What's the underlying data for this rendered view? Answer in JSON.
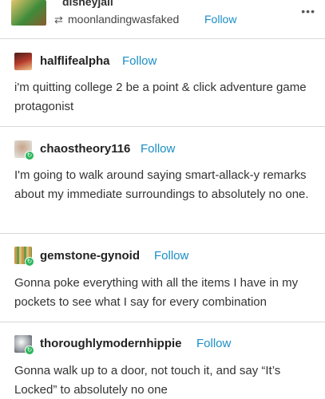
{
  "header": {
    "blog_name": "disneyjail",
    "reblog_icon": "reblog-icon",
    "reblogged_from": "moonlandingwasfaked",
    "follow_label": "Follow",
    "more_label": "•••"
  },
  "posts": [
    {
      "username": "halflifealpha",
      "follow_label": "Follow",
      "text": "i'm quitting college 2 be a point & click adventure game protagonist"
    },
    {
      "username": "chaostheory116",
      "follow_label": "Follow",
      "text": "I'm going to walk around saying smart-allack-y remarks about my immediate surroundings to absolutely no one."
    },
    {
      "username": "gemstone-gynoid",
      "follow_label": "Follow",
      "text": "Gonna poke everything with all the items I have in my pockets to see what I say for every combination"
    },
    {
      "username": "thoroughlymodernhippie",
      "follow_label": "Follow",
      "text": "Gonna walk up to a door, not touch it, and say “It’s Locked” to absolutely no one"
    }
  ],
  "colors": {
    "link": "#1a8ec5",
    "badge": "#2bb55a",
    "divider": "#d8d8d8"
  }
}
